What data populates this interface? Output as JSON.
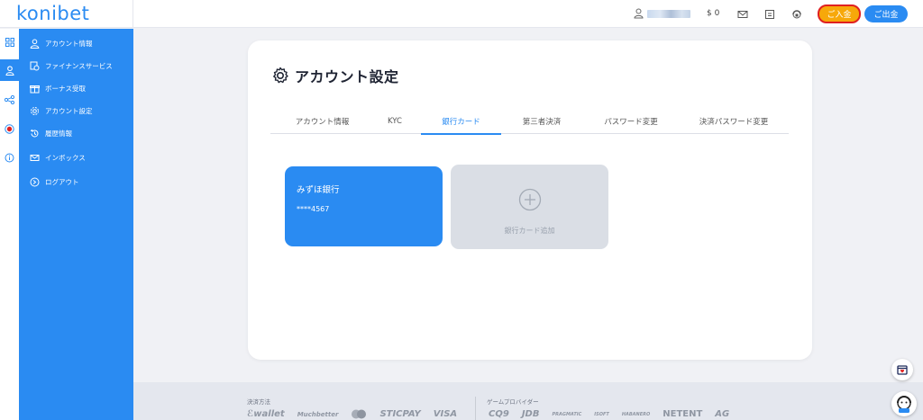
{
  "header": {
    "logo": "konibet",
    "balance": "$ 0",
    "deposit_label": "ご入金",
    "withdraw_label": "ご出金"
  },
  "sidebar": {
    "items": [
      {
        "label": "アカウント情報",
        "icon": "user-icon"
      },
      {
        "label": "ファイナンスサービス",
        "icon": "finance-icon"
      },
      {
        "label": "ボーナス受取",
        "icon": "gift-icon"
      },
      {
        "label": "アカウント設定",
        "icon": "gear-icon"
      },
      {
        "label": "履歴情報",
        "icon": "history-icon"
      },
      {
        "label": "インボックス",
        "icon": "mail-icon"
      },
      {
        "label": "ログアウト",
        "icon": "logout-icon"
      }
    ]
  },
  "page": {
    "title": "アカウント設定"
  },
  "tabs": [
    {
      "label": "アカウント情報",
      "active": false
    },
    {
      "label": "KYC",
      "active": false
    },
    {
      "label": "銀行カード",
      "active": true
    },
    {
      "label": "第三者決済",
      "active": false
    },
    {
      "label": "パスワード変更",
      "active": false
    },
    {
      "label": "決済パスワード変更",
      "active": false
    }
  ],
  "bank_card": {
    "name": "みずほ銀行",
    "number": "****4567"
  },
  "add_card": {
    "label": "銀行カード追加"
  },
  "footer": {
    "payment_label": "決済方法",
    "provider_label": "ゲームプロバイダー",
    "payment_logos": [
      "ℰwallet",
      "Muchbetter",
      "Mastercard",
      "STICPAY",
      "VISA"
    ],
    "provider_logos": [
      "CQ9",
      "JDB",
      "PRAGMATIC",
      "ISOFT",
      "HABANERO",
      "NETENT",
      "AG"
    ]
  },
  "colors": {
    "primary": "#2a8bf2",
    "deposit": "#f7a80a",
    "highlight_border": "#e02020",
    "add_card_bg": "#dadee5"
  }
}
